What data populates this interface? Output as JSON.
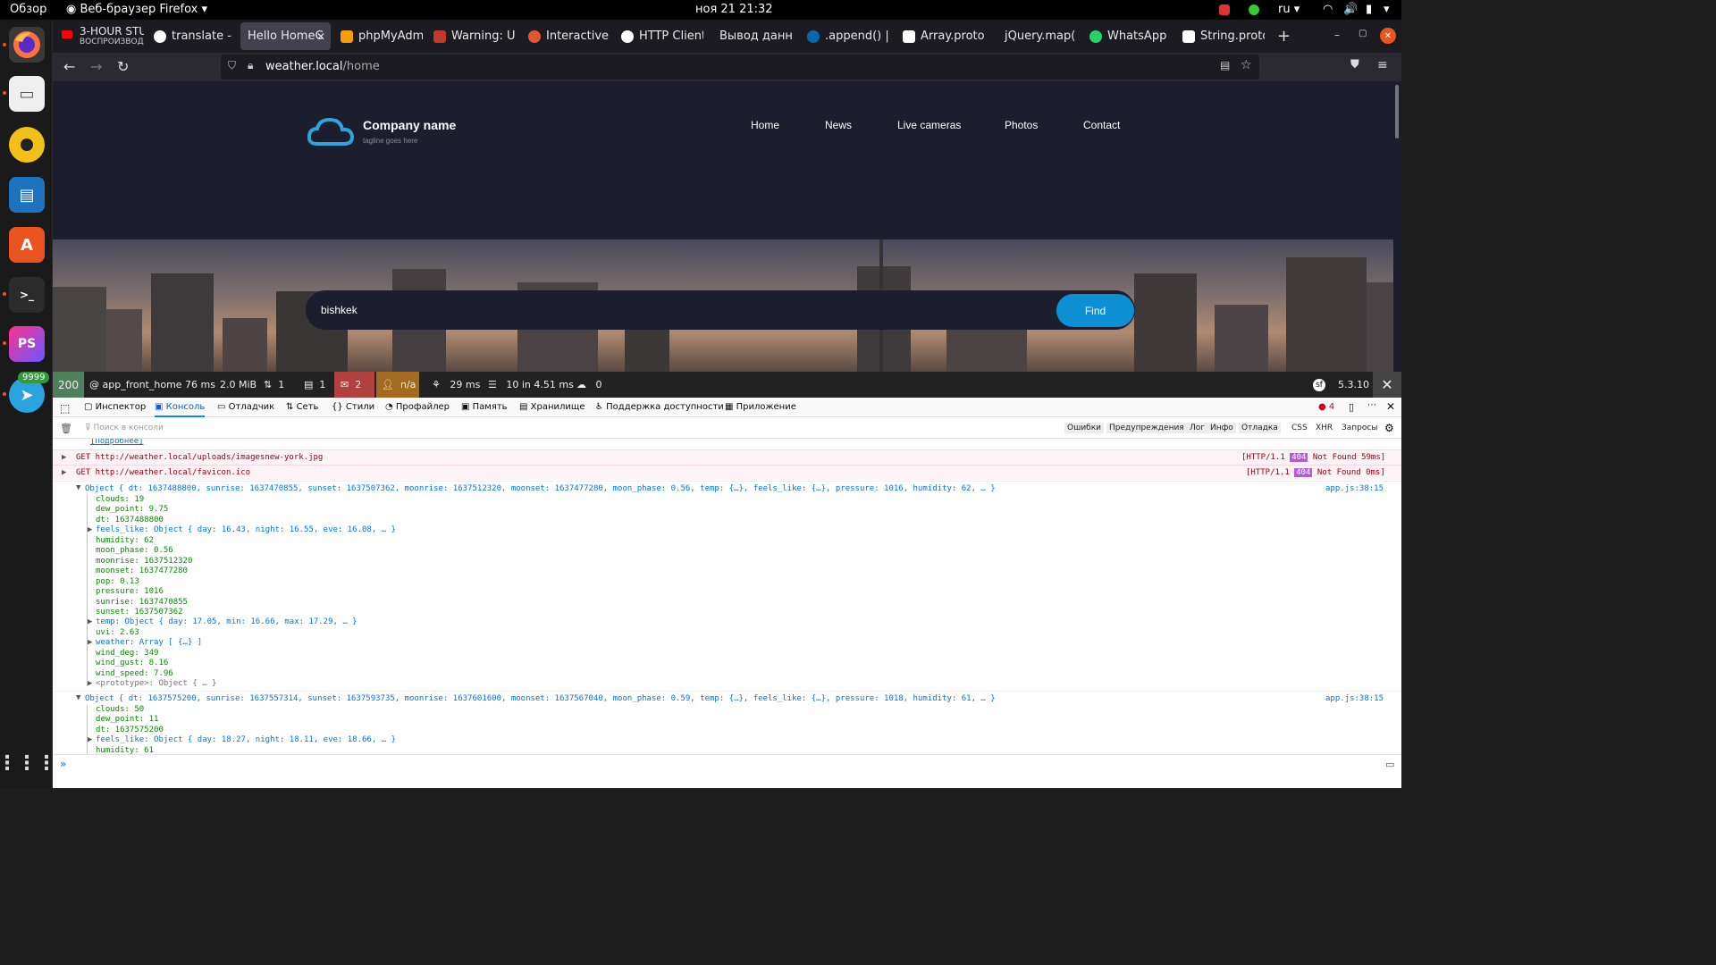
{
  "topbar": {
    "overview": "Обзор",
    "app_name": "Веб-браузер Firefox",
    "clock": "ноя 21  21:32",
    "lang": "ru"
  },
  "dock": {
    "telegram_badge": "9999",
    "phpstorm_label": "PS"
  },
  "tabs": [
    {
      "title": "3-HOUR STU",
      "subtitle": "ВОСПРОИЗВОД",
      "color": "#ff0000"
    },
    {
      "title": "translate - П",
      "color": "#4285f4"
    },
    {
      "title": "Hello HomeC",
      "color": "",
      "active": true
    },
    {
      "title": "phpMyAdmi",
      "color": "#f89c0e"
    },
    {
      "title": "Warning: Un",
      "color": "#c0392b"
    },
    {
      "title": "Interactive w",
      "color": "#e4572e"
    },
    {
      "title": "HTTP Client",
      "color": "#ffffff"
    },
    {
      "title": "Вывод данн",
      "color": ""
    },
    {
      "title": ".append() | jQ",
      "color": "#0769ad"
    },
    {
      "title": "Array.protot",
      "color": "#ffffff"
    },
    {
      "title": "jQuery.map(",
      "color": ""
    },
    {
      "title": "WhatsApp",
      "color": "#25d366"
    },
    {
      "title": "String.protot",
      "color": "#ffffff"
    }
  ],
  "url": {
    "host": "weather.local",
    "path": "/home"
  },
  "site": {
    "company": "Company name",
    "tagline": "tagline goes here",
    "menu": [
      "Home",
      "News",
      "Live cameras",
      "Photos",
      "Contact"
    ],
    "search_value": "bishkek",
    "find": "Find"
  },
  "symfony": {
    "status": "200",
    "route": "@ app_front_home",
    "time": "76 ms",
    "memory": "2.0 MiB",
    "forms": "1",
    "logs": "1",
    "errors": "2",
    "user": "n/a",
    "twig": "29 ms",
    "db": "10 in 4.51 ms",
    "cache": "0",
    "version": "5.3.10"
  },
  "devtools": {
    "tabs": [
      "Инспектор",
      "Консоль",
      "Отладчик",
      "Сеть",
      "Стили",
      "Профайлер",
      "Память",
      "Хранилище",
      "Поддержка доступности",
      "Приложение"
    ],
    "error_count": "4",
    "filter_placeholder": "Поиск в консоли",
    "filters": [
      "Ошибки",
      "Предупреждения",
      "Лог",
      "Инфо",
      "Отладка"
    ],
    "filters2": [
      "CSS",
      "XHR",
      "Запросы"
    ],
    "more_link": "[Подробнее]",
    "req1": "GET http://weather.local/uploads/imagesnew-york.jpg",
    "req2": "GET http://weather.local/favicon.ico",
    "req1_status": "[HTTP/1.1",
    "req1_code": "404",
    "req1_tail": "Not Found 59ms]",
    "req2_status": "[HTTP/1.1",
    "req2_code": "404",
    "req2_tail": "Not Found 0ms]",
    "obj1_header": "Object { dt: 1637488800, sunrise: 1637470855, sunset: 1637507362, moonrise: 1637512320, moonset: 1637477280, moon_phase: 0.56, temp: {…}, feels_like: {…}, pressure: 1016, humidity: 62, … }",
    "obj1_lines": [
      "clouds: 19",
      "dew_point: 9.75",
      "dt: 1637488800",
      "feels_like: Object { day: 16.43, night: 16.55, eve: 16.08, … }",
      "humidity: 62",
      "moon_phase: 0.56",
      "moonrise: 1637512320",
      "moonset: 1637477280",
      "pop: 0.13",
      "pressure: 1016",
      "sunrise: 1637470855",
      "sunset: 1637507362",
      "temp: Object { day: 17.05, min: 16.66, max: 17.29, … }",
      "uvi: 2.63",
      "weather: Array [ {…} ]",
      "wind_deg: 349",
      "wind_gust: 8.16",
      "wind_speed: 7.96",
      "<prototype>: Object { … }"
    ],
    "obj2_header": "Object { dt: 1637575200, sunrise: 1637557314, sunset: 1637593735, moonrise: 1637601600, moonset: 1637567040, moon_phase: 0.59, temp: {…}, feels_like: {…}, pressure: 1018, humidity: 61, … }",
    "obj2_lines": [
      "clouds: 50",
      "dew_point: 11",
      "dt: 1637575200",
      "feels_like: Object { day: 18.27, night: 18.11, eve: 18.66, … }",
      "humidity: 61"
    ],
    "source": "app.js:38:15"
  }
}
